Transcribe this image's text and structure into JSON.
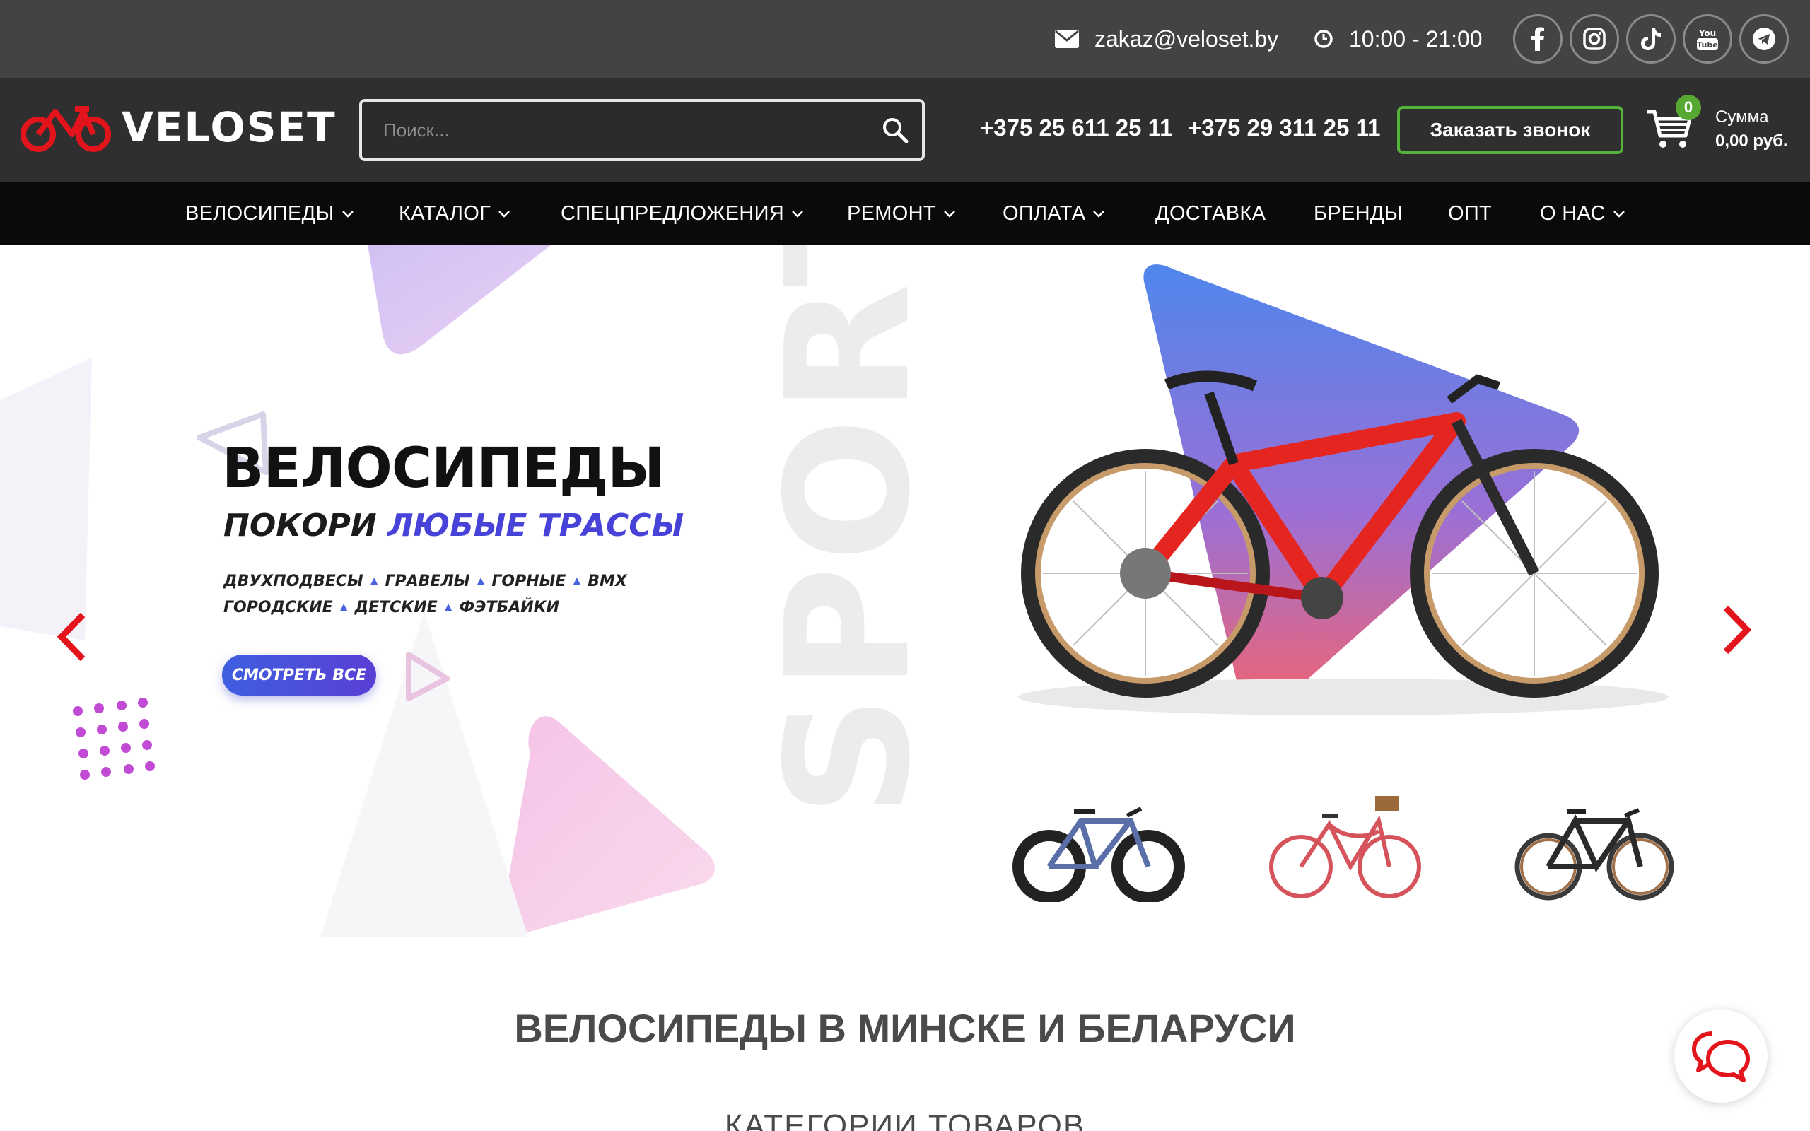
{
  "topbar": {
    "email": "zakaz@veloset.by",
    "hours": "10:00 - 21:00",
    "socials": [
      "facebook-icon",
      "instagram-icon",
      "tiktok-icon",
      "youtube-icon",
      "telegram-icon"
    ]
  },
  "header": {
    "logo_text": "VELOSET",
    "search_placeholder": "Поиск...",
    "phones": [
      "+375 25 611 25 11",
      "+375 29 311 25 11"
    ],
    "call_button": "Заказать звонок",
    "cart_count": "0",
    "sum_label": "Сумма",
    "sum_value": "0,00 руб."
  },
  "nav": {
    "items": [
      {
        "label": "ВЕЛОСИПЕДЫ",
        "dropdown": true
      },
      {
        "label": "КАТАЛОГ",
        "dropdown": true
      },
      {
        "label": "СПЕЦПРЕДЛОЖЕНИЯ",
        "dropdown": true
      },
      {
        "label": "РЕМОНТ",
        "dropdown": true
      },
      {
        "label": "ОПЛАТА",
        "dropdown": true
      },
      {
        "label": "ДОСТАВКА",
        "dropdown": false
      },
      {
        "label": "БРЕНДЫ",
        "dropdown": false
      },
      {
        "label": "ОПТ",
        "dropdown": false
      },
      {
        "label": "О НАС",
        "dropdown": true
      }
    ]
  },
  "hero": {
    "title": "ВЕЛОСИПЕДЫ",
    "sub_a": "ПОКОРИ",
    "sub_b": "ЛЮБЫЕ ТРАССЫ",
    "line1": [
      "ДВУХПОДВЕСЫ",
      "ГРАВЕЛЫ",
      "ГОРНЫЕ",
      "BMX"
    ],
    "line2": [
      "ГОРОДСКИЕ",
      "ДЕТСКИЕ",
      "ФЭТБАЙКИ"
    ],
    "cta": "СМОТРЕТЬ ВСЕ",
    "watermark": "SPORT"
  },
  "sections": {
    "title": "ВЕЛОСИПЕДЫ В МИНСКЕ И БЕЛАРУСИ",
    "subtitle": "КАТЕГОРИИ ТОВАРОВ"
  },
  "colors": {
    "topbar": "#434343",
    "header": "#2f2f2f",
    "nav": "#0a0a0a",
    "accent_red": "#e3141b",
    "call_border": "#53b33a",
    "hero_blue": "#4743d8"
  }
}
